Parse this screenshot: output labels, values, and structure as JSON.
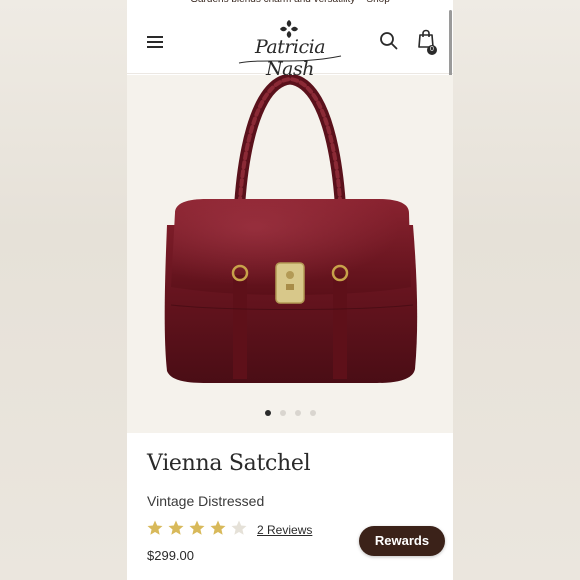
{
  "promo_banner": "Gardens blends charm and versatility – Shop",
  "header": {
    "logo_text": "Patricia Nash",
    "cart_count": "0",
    "icons": [
      "menu-icon",
      "search-icon",
      "shopping-bag-icon"
    ]
  },
  "gallery": {
    "image_alt": "Vienna Satchel in burgundy leather",
    "slide_count": 4,
    "active_slide": 1
  },
  "product": {
    "name": "Vienna Satchel",
    "variant": "Vintage Distressed",
    "rating": 4,
    "rating_max": 5,
    "reviews_label": "2 Reviews",
    "price": "$299.00"
  },
  "rewards_label": "Rewards",
  "colors": {
    "accent_dark": "#3b2219",
    "star_gold": "#d8b95a",
    "star_empty": "#e5e1d8",
    "bag_leather": "#6d1620"
  }
}
